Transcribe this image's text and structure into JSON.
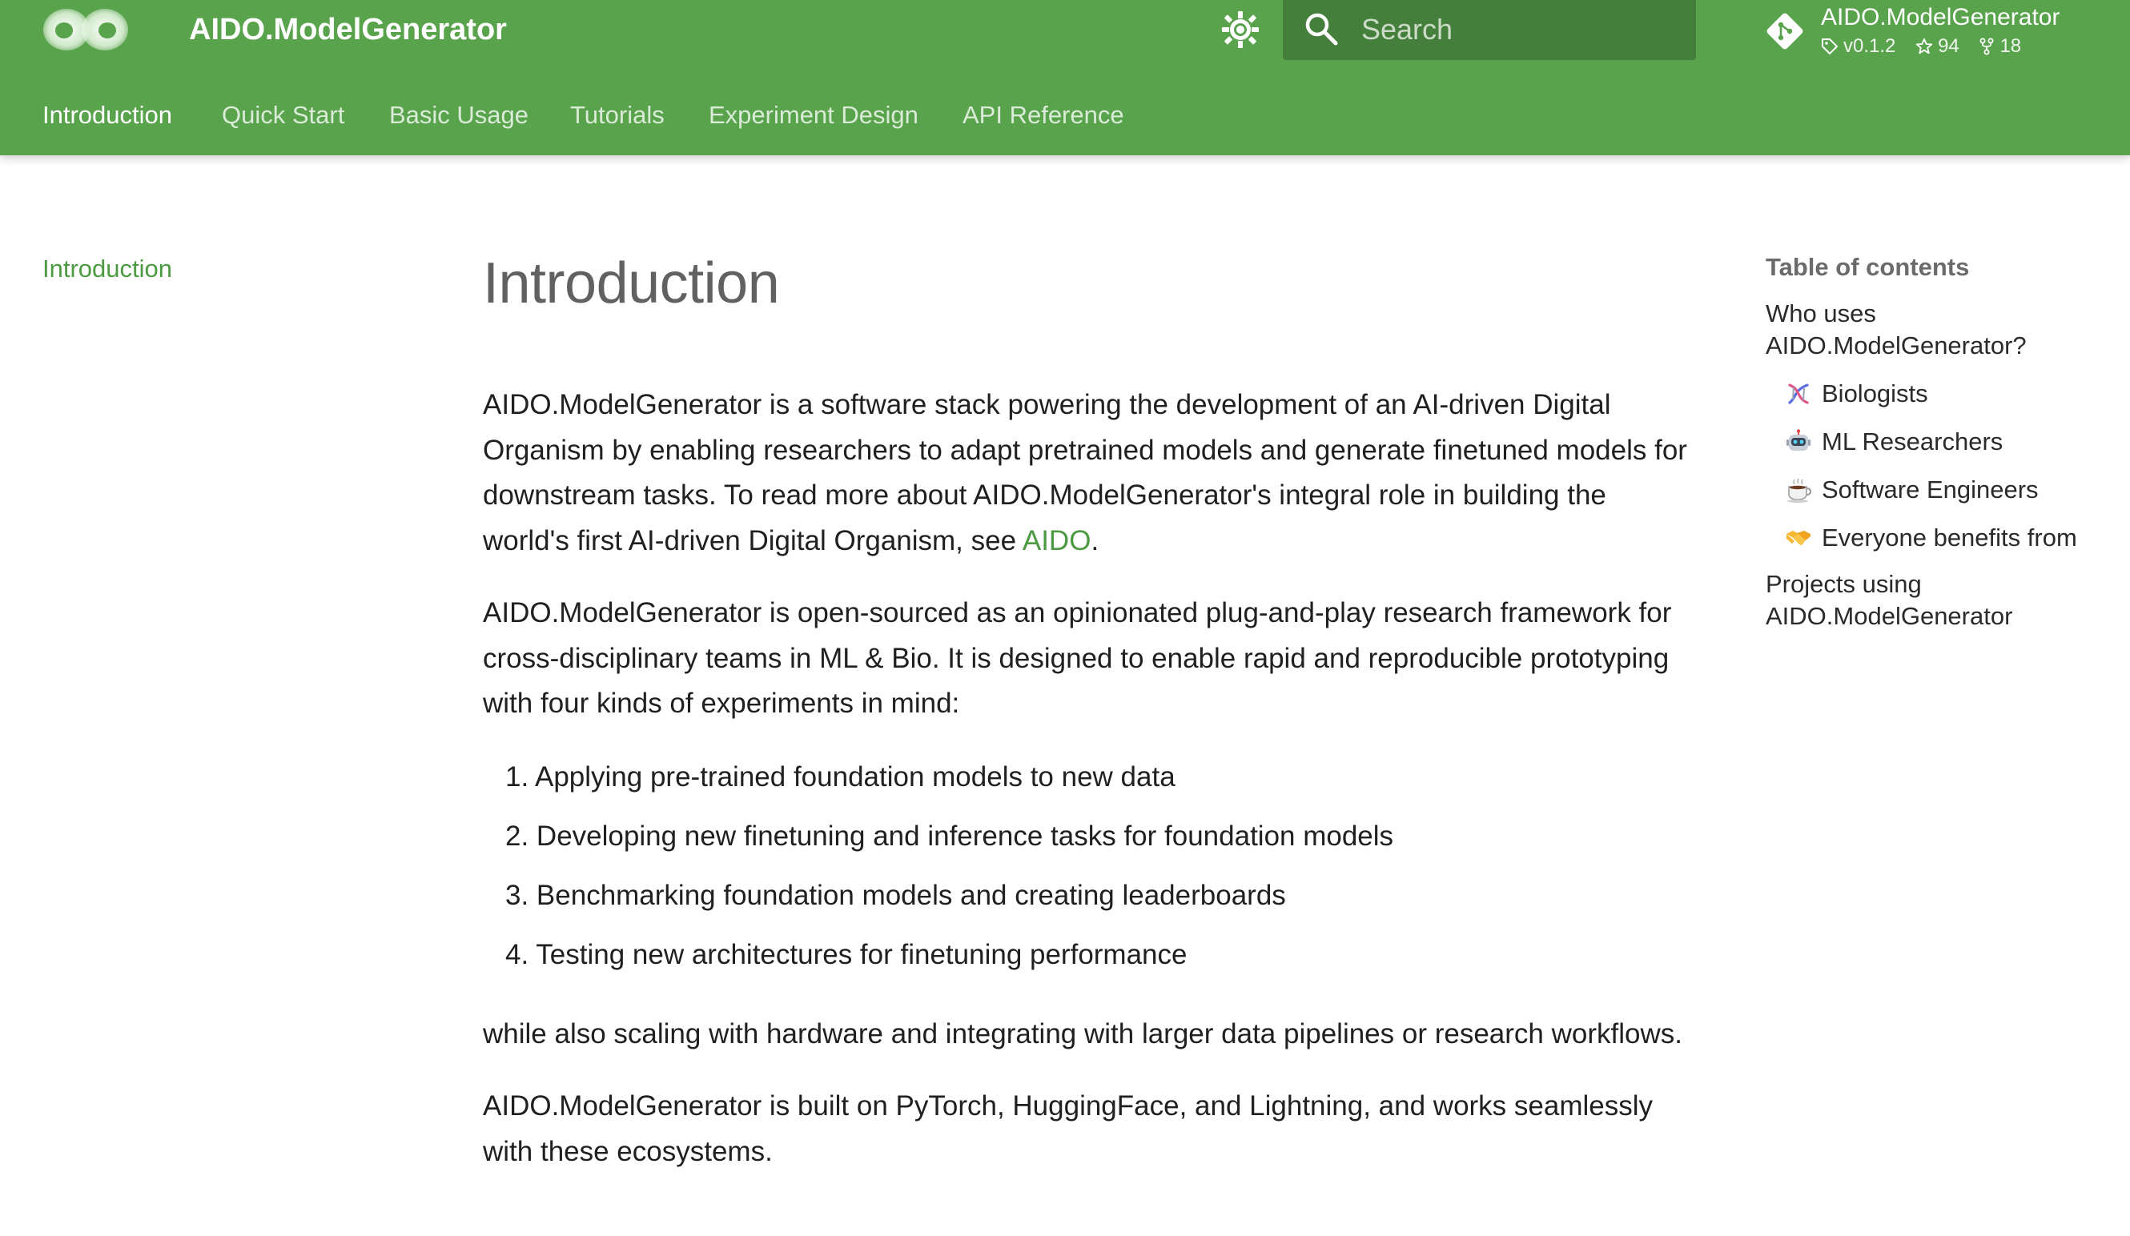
{
  "header": {
    "site_title": "AIDO.ModelGenerator",
    "search_placeholder": "Search",
    "repo": {
      "name": "AIDO.ModelGenerator",
      "version": "v0.1.2",
      "stars": "94",
      "forks": "18"
    },
    "tabs": [
      {
        "label": "Introduction",
        "active": true
      },
      {
        "label": "Quick Start",
        "active": false
      },
      {
        "label": "Basic Usage",
        "active": false
      },
      {
        "label": "Tutorials",
        "active": false
      },
      {
        "label": "Experiment Design",
        "active": false
      },
      {
        "label": "API Reference",
        "active": false
      }
    ],
    "colors": {
      "header_bg": "#58a34c",
      "search_bg": "#447f3b"
    }
  },
  "sidebar": {
    "items": [
      {
        "label": "Introduction",
        "active": true
      }
    ]
  },
  "content": {
    "title": "Introduction",
    "p1_text": "AIDO.ModelGenerator is a software stack powering the development of an AI-driven Digital Organism by enabling researchers to adapt pretrained models and generate finetuned models for downstream tasks. To read more about AIDO.ModelGenerator's integral role in building the world's first AI-driven Digital Organism, see ",
    "p1_link": "AIDO",
    "p1_end": ".",
    "p2": "AIDO.ModelGenerator is open-sourced as an opinionated plug-and-play research framework for cross-disciplinary teams in ML & Bio. It is designed to enable rapid and reproducible prototyping with four kinds of experiments in mind:",
    "list": [
      "1. Applying pre-trained foundation models to new data",
      "2. Developing new finetuning and inference tasks for foundation models",
      "3. Benchmarking foundation models and creating leaderboards",
      "4. Testing new architectures for finetuning performance"
    ],
    "p3": "while also scaling with hardware and integrating with larger data pipelines or research workflows.",
    "p4": "AIDO.ModelGenerator is built on PyTorch, HuggingFace, and Lightning, and works seamlessly with these ecosystems."
  },
  "toc": {
    "heading": "Table of contents",
    "items": [
      {
        "label": "Who uses AIDO.ModelGenerator?",
        "level": 1
      },
      {
        "label": "Biologists",
        "level": 2,
        "icon": "dna-icon"
      },
      {
        "label": "ML Researchers",
        "level": 2,
        "icon": "robot-icon"
      },
      {
        "label": "Software Engineers",
        "level": 2,
        "icon": "coffee-icon"
      },
      {
        "label": "Everyone benefits from",
        "level": 2,
        "icon": "handshake-icon"
      },
      {
        "label": "Projects using AIDO.ModelGenerator",
        "level": 1
      }
    ]
  },
  "colors": {
    "link": "#4c9a41",
    "title": "#616161",
    "text": "#202020"
  }
}
